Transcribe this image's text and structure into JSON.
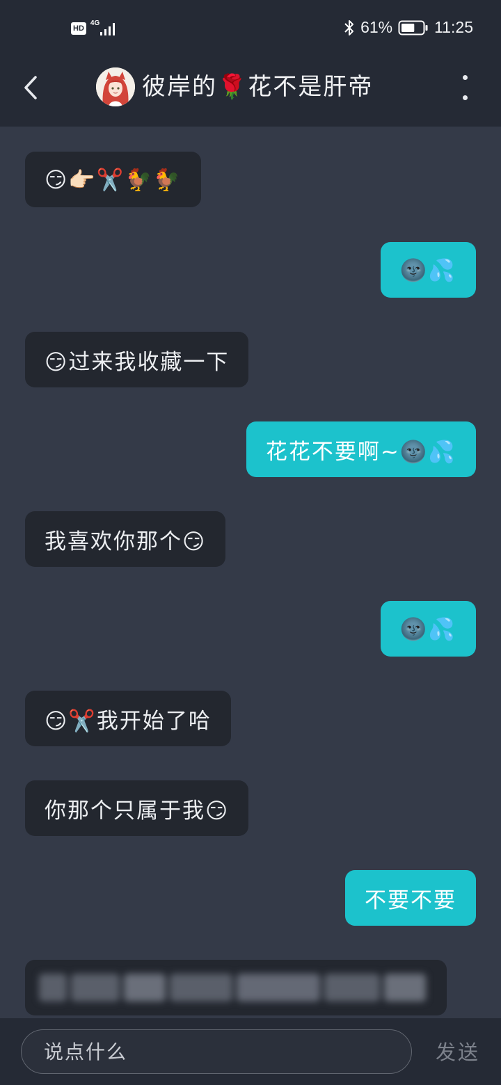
{
  "status_bar": {
    "hd_label": "HD",
    "network_label": "4G",
    "battery_percent": "61%",
    "battery_level": 0.61,
    "time": "11:25",
    "icons": [
      "hd-icon",
      "signal-icon",
      "bluetooth-icon",
      "battery-icon"
    ]
  },
  "header": {
    "title": "彼岸的🌹花不是肝帝",
    "back_icon": "chevron-left-icon",
    "more_icon": "more-vertical-icon"
  },
  "messages": [
    {
      "side": "incoming",
      "text": "😏👉🏻✂️🐓🐓"
    },
    {
      "side": "outgoing",
      "text": "🌚💦"
    },
    {
      "side": "incoming",
      "text": "😏过来我收藏一下"
    },
    {
      "side": "outgoing",
      "text": "花花不要啊~🌚💦"
    },
    {
      "side": "incoming",
      "text": "我喜欢你那个😏"
    },
    {
      "side": "outgoing",
      "text": "🌚💦"
    },
    {
      "side": "incoming",
      "text": "😏✂️我开始了哈"
    },
    {
      "side": "incoming",
      "text": "你那个只属于我😏"
    },
    {
      "side": "outgoing",
      "text": "不要不要"
    }
  ],
  "input_bar": {
    "placeholder": "说点什么",
    "send_label": "发送"
  },
  "colors": {
    "background": "#343a48",
    "bar": "#252a35",
    "incoming_bubble": "#23272f",
    "outgoing_bubble": "#1cc2cc"
  }
}
